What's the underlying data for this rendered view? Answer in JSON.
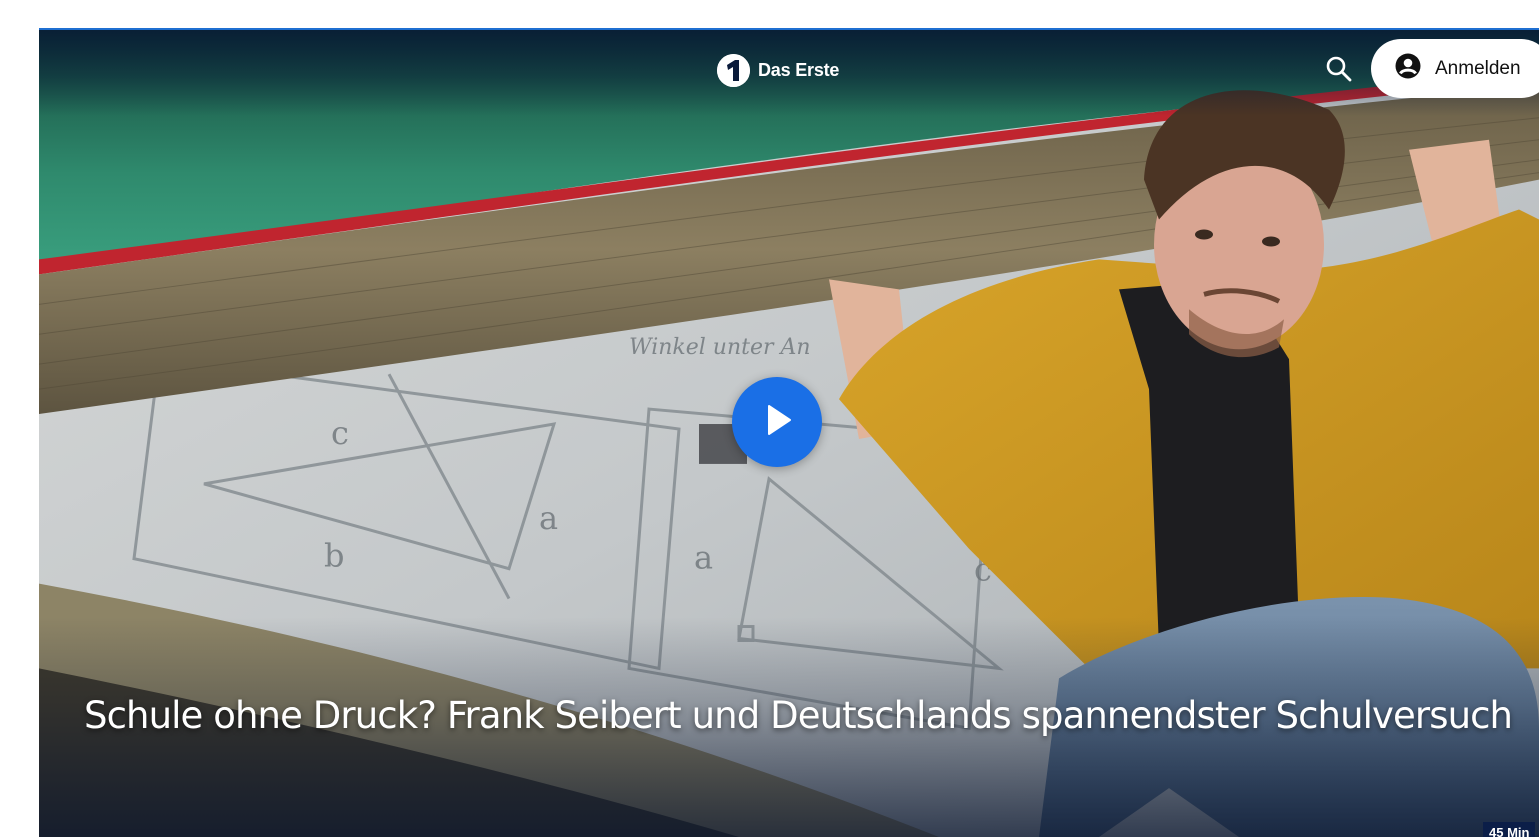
{
  "header": {
    "brand_name": "Das Erste",
    "login_label": "Anmelden"
  },
  "icons": {
    "brand_logo": "ard-one-logo",
    "search": "search-icon",
    "login": "user-icon",
    "play": "play-icon"
  },
  "hero": {
    "title": "Schule ohne Druck? Frank Seibert und Deutschlands spannendster Schulversuch",
    "duration": "45 Min"
  },
  "colors": {
    "accent": "#1a6fe6",
    "header_overlay": "#061634",
    "badge": "#0b1e48"
  }
}
